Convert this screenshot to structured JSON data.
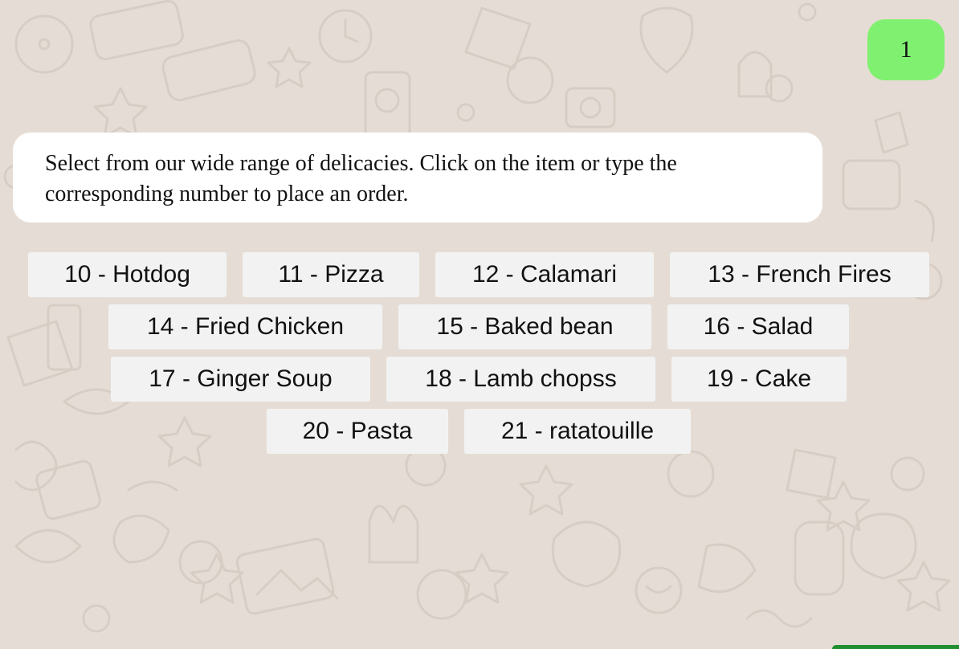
{
  "chat": {
    "sent_message": "1",
    "bot_message": "Select from our wide range of delicacies. Click on the item or type the corresponding number to place an order."
  },
  "menu": {
    "items": [
      {
        "label": "10 - Hotdog"
      },
      {
        "label": "11 - Pizza"
      },
      {
        "label": "12 - Calamari"
      },
      {
        "label": "13 - French Fires"
      },
      {
        "label": "14 - Fried Chicken"
      },
      {
        "label": "15 - Baked bean"
      },
      {
        "label": "16 - Salad"
      },
      {
        "label": "17 - Ginger Soup"
      },
      {
        "label": "18 - Lamb chopss"
      },
      {
        "label": "19 - Cake"
      },
      {
        "label": "20 - Pasta"
      },
      {
        "label": "21 - ratatouille"
      }
    ]
  },
  "colors": {
    "background": "#e5ddd5",
    "sent_bubble": "#7ff070",
    "bot_bubble": "#ffffff",
    "menu_button": "#f2f2f2"
  }
}
